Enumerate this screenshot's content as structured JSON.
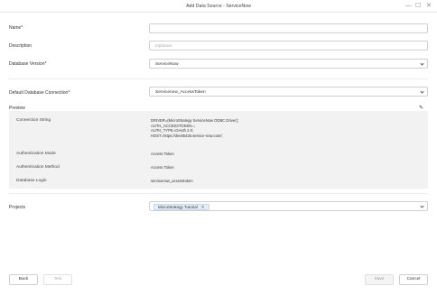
{
  "window": {
    "title": "Add Data Source - ServiceNow",
    "minimize_glyph": "—",
    "maximize_glyph": "☐",
    "close_glyph": "✕"
  },
  "form": {
    "name": {
      "label": "Name*",
      "value": ""
    },
    "description": {
      "label": "Description",
      "placeholder": "Optional"
    },
    "database_version": {
      "label": "Database Version*",
      "value": "ServiceNow"
    },
    "default_connection": {
      "label": "Default Database Connection*",
      "value": "Servicenow_AccessToken"
    },
    "projects": {
      "label": "Projects",
      "tags": [
        "MicroStrategy Tutorial"
      ]
    }
  },
  "preview": {
    "title": "Preview",
    "rows": [
      {
        "label": "Connection String",
        "value": "DRIVER={MicroStrategy ServiceNow ODBC Driver};\nAUTH_ACCESSTOKEN=;\nAUTH_TYPE=OAuth 2.0;\nHOST=https://dev85435.service-now.com/;"
      },
      {
        "label": "Authentication Mode",
        "value": "Access Token"
      },
      {
        "label": "Authentication Method",
        "value": "Access Token"
      },
      {
        "label": "Database Login",
        "value": "servicenow_accesstoken"
      }
    ]
  },
  "footer": {
    "back_label": "Back",
    "test_label": "Test",
    "save_label": "Save",
    "cancel_label": "Cancel"
  }
}
